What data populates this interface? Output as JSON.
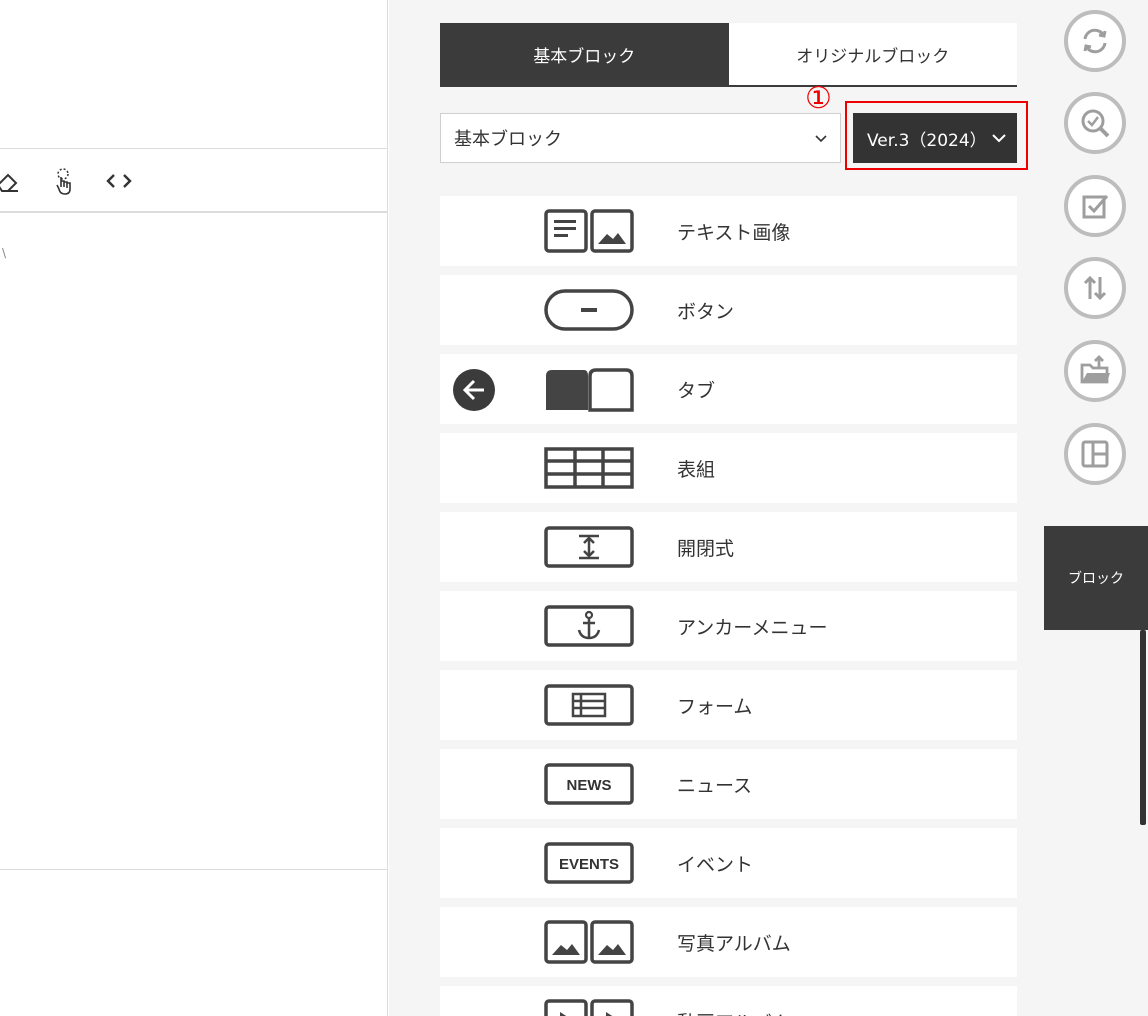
{
  "tabs": [
    {
      "label": "基本ブロック",
      "active": true
    },
    {
      "label": "オリジナルブロック",
      "active": false
    }
  ],
  "category_select": {
    "value": "基本ブロック"
  },
  "annotation": {
    "number": "①",
    "color": "#e00000"
  },
  "version_select": {
    "value": "Ver.3（2024）"
  },
  "editor": {
    "tiny_mark": "\\"
  },
  "blocks": [
    {
      "label": "テキスト画像",
      "icon": "text-image-icon"
    },
    {
      "label": "ボタン",
      "icon": "button-icon"
    },
    {
      "label": "タブ",
      "icon": "tab-icon"
    },
    {
      "label": "表組",
      "icon": "table-icon"
    },
    {
      "label": "開閉式",
      "icon": "accordion-icon"
    },
    {
      "label": "アンカーメニュー",
      "icon": "anchor-icon"
    },
    {
      "label": "フォーム",
      "icon": "form-icon"
    },
    {
      "label": "ニュース",
      "icon": "news-icon",
      "icon_text": "NEWS"
    },
    {
      "label": "イベント",
      "icon": "events-icon",
      "icon_text": "EVENTS"
    },
    {
      "label": "写真アルバム",
      "icon": "photo-album-icon"
    },
    {
      "label": "動画アルバム",
      "icon": "video-album-icon"
    }
  ],
  "rail": {
    "buttons": [
      "refresh-icon",
      "search-check-icon",
      "checkbox-icon",
      "sort-icon",
      "folder-export-icon",
      "layout-icon"
    ],
    "active_label": "ブロック"
  },
  "colors": {
    "dark": "#3b3b3b",
    "panel_bg": "#f5f5f5",
    "accent_red": "#e00000"
  }
}
